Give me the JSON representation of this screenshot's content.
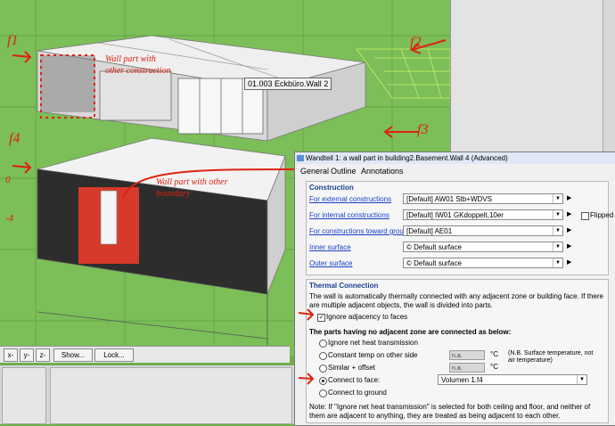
{
  "viewport": {
    "tooltip": "01.003 Eckbüro.Wall 2",
    "annotations": {
      "f1": "f1",
      "f2": "f2",
      "f3": "f3",
      "f4": "f4",
      "top_note": "Wall part with other construction",
      "bottom_note": "Wall part with other boundary",
      "zero": "0",
      "minus4": "-4"
    }
  },
  "toolbar": {
    "x_minus": "x-",
    "y_minus": "y-",
    "z_minus": "z-",
    "show": "Show...",
    "lock": "Lock..."
  },
  "dialog": {
    "title": "Wandteil 1: a wall part in building2.Basement.Wall 4 (Advanced)",
    "tabs": [
      "General",
      "Outline",
      "Annotations"
    ],
    "construction": {
      "heading": "Construction",
      "rows": [
        {
          "label": "For external constructions",
          "value": "[Default] AW01 Stb+WDVS"
        },
        {
          "label": "For internal constructions",
          "value": "[Default] IW01 GKdoppelt,10er"
        },
        {
          "label": "For constructions toward ground",
          "value": "[Default] AE01"
        },
        {
          "label": "Inner surface",
          "value": "© Default surface"
        },
        {
          "label": "Outer surface",
          "value": "© Default surface"
        }
      ],
      "flipped": "Flipped"
    },
    "thermal": {
      "heading": "Thermal Connection",
      "desc": "The wall is automatically thermally connected with any adjacent zone or building face. If there are multiple adjacent objects, the wall is divided into parts.",
      "ignore_adjacency": "Ignore adjacency to faces",
      "subheading": "The parts having no adjacent zone are connected as below:",
      "options": [
        "Ignore net heat transmission",
        "Constant temp on other side",
        "Similar + offset",
        "Connect to face:",
        "Connect to ground"
      ],
      "na1": "n.a.",
      "na2": "n.a.",
      "unit1": "°C",
      "unit2": "°C",
      "note_side": "(N.B. Surface temperature, not air temperature)",
      "face_value": "Volumen 1.f4",
      "footnote": "Note: If \"Ignore net heat transmission\" is selected for both ceiling and floor, and neither of them are adjacent to anything, they are treated as being adjacent to each other."
    }
  }
}
